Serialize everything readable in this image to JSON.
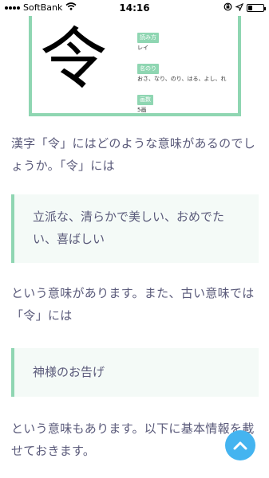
{
  "status_bar": {
    "carrier": "SoftBank",
    "time": "14:16",
    "battery_level": 0.3,
    "icons": [
      "signal-icon",
      "wifi-icon",
      "screen-rotation-lock-icon",
      "location-arrow-icon",
      "battery-icon"
    ]
  },
  "kanji": {
    "character": "令",
    "reading_label": "読み方",
    "reading_value": "レイ",
    "nanori_label": "名のり",
    "nanori_value": "おさ、なり、のり、はる、よし、れ",
    "strokes_label": "画数",
    "strokes_value": "5画"
  },
  "article": {
    "para1": "漢字「令」にはどのような意味があるのでしょうか。「令」には",
    "quote1": "立派な、清らかで美しい、おめでたい、喜ばしい",
    "para2": "という意味があります。また、古い意味では「令」には",
    "quote2": "神様のお告げ",
    "para3": "という意味もあります。以下に基本情報を載せておきます。"
  },
  "colors": {
    "accent_green": "#8fd6b2",
    "quote_bg": "#f4faf7",
    "text": "#5a5a7a",
    "scroll_button": "#44b4f0"
  },
  "scroll_top_icon": "chevron-up-icon"
}
